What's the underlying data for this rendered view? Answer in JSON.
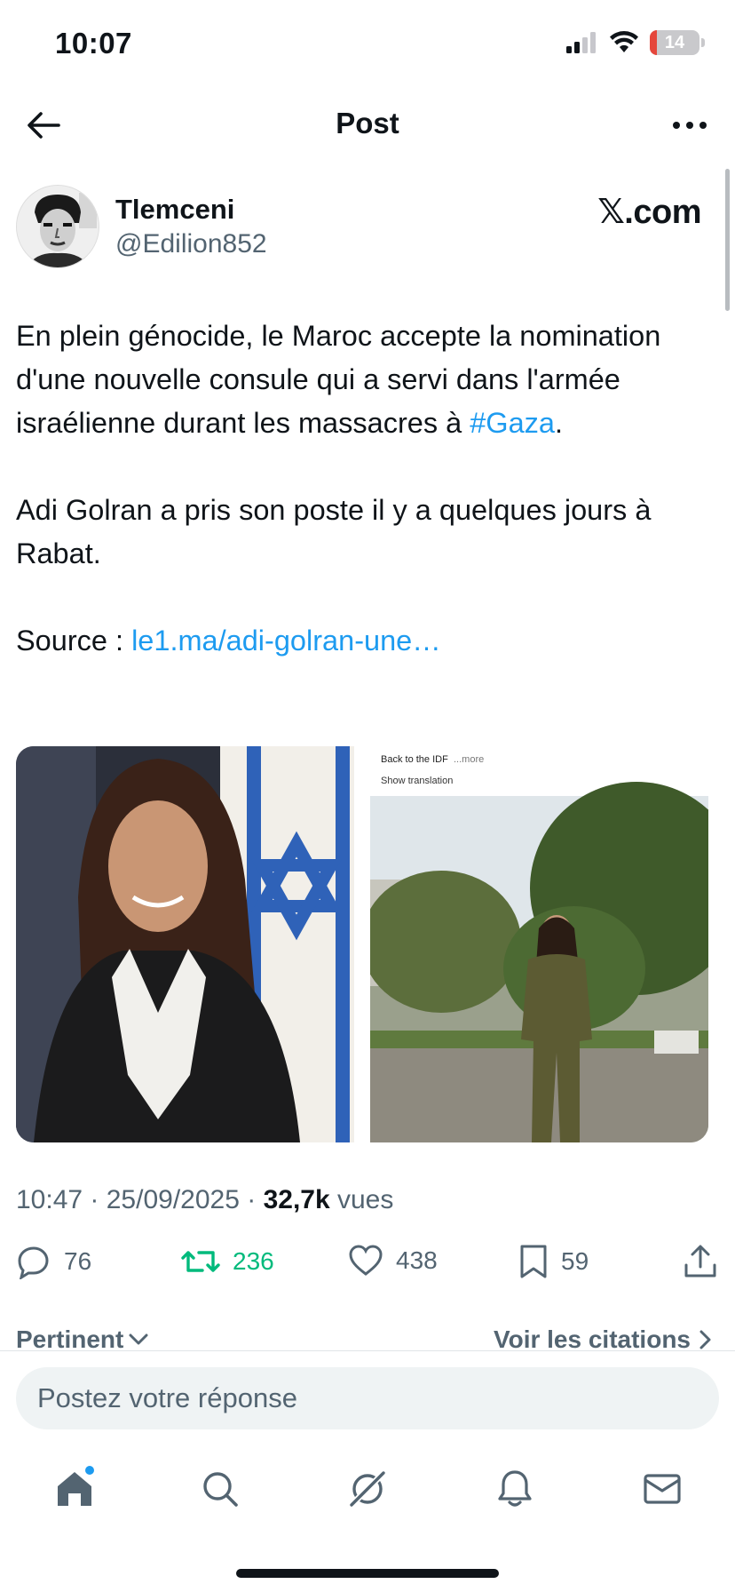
{
  "status_bar": {
    "time": "10:07",
    "battery": "14"
  },
  "header": {
    "title": "Post"
  },
  "author": {
    "name": "Tlemceni",
    "handle": "@Edilion852",
    "brand": "𝕏.com"
  },
  "tweet": {
    "p1_text": "En plein génocide, le Maroc accepte la nomination d'une nouvelle consule qui a servi dans l'armée israélienne durant les massacres à ",
    "p1_hashtag": "#Gaza",
    "p1_end": ".",
    "p2": "Adi Golran a pris son poste il y a quelques jours à Rabat.",
    "p3_label": "Source : ",
    "p3_link": "le1.ma/adi-golran-une…"
  },
  "media": {
    "right_caption_line1": "Back to the IDF",
    "right_caption_more": "...more",
    "right_caption_line2": "Show translation"
  },
  "meta": {
    "time": "10:47",
    "sep1": " · ",
    "date": "25/09/2025",
    "sep2": " · ",
    "views_count": "32,7k",
    "views_label": " vues"
  },
  "actions": {
    "replies": "76",
    "reposts": "236",
    "likes": "438",
    "bookmarks": "59"
  },
  "sort": {
    "left": "Pertinent",
    "right": "Voir les citations"
  },
  "reply": {
    "placeholder": "Postez votre réponse"
  },
  "nav": [
    "home-icon",
    "search-icon",
    "grok-icon",
    "bell-icon",
    "mail-icon"
  ],
  "colors": {
    "link": "#1d9bf0",
    "repost": "#00ba7c",
    "muted": "#536471",
    "text": "#0f1419"
  }
}
